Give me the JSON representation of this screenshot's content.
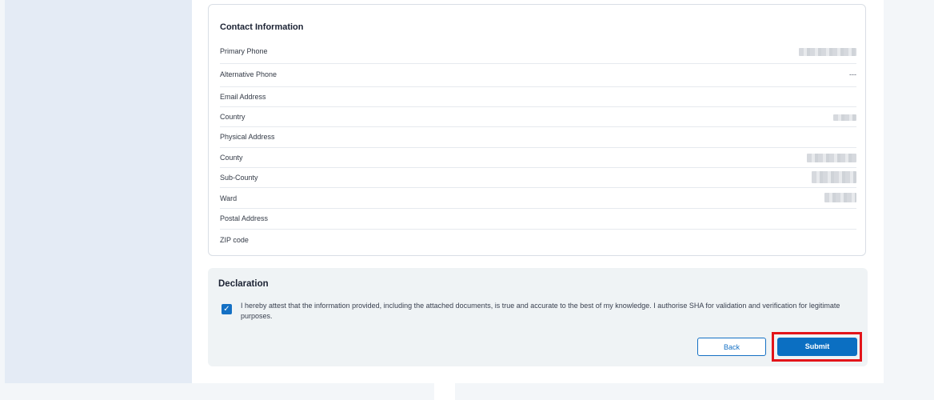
{
  "contact": {
    "title": "Contact Information",
    "rows": [
      {
        "label": "Primary Phone",
        "value": ""
      },
      {
        "label": "Alternative Phone",
        "value": "---"
      },
      {
        "label": "Email Address",
        "value": ""
      },
      {
        "label": "Country",
        "value": ""
      },
      {
        "label": "Physical Address",
        "value": ""
      },
      {
        "label": "County",
        "value": ""
      },
      {
        "label": "Sub-County",
        "value": ""
      },
      {
        "label": "Ward",
        "value": ""
      },
      {
        "label": "Postal Address",
        "value": ""
      },
      {
        "label": "ZIP code",
        "value": ""
      }
    ]
  },
  "declaration": {
    "title": "Declaration",
    "checked": true,
    "text": "I hereby attest that the information provided, including the attached documents, is true and accurate to the best of my knowledge. I authorise SHA for validation and verification for legitimate purposes."
  },
  "actions": {
    "back_label": "Back",
    "submit_label": "Submit"
  },
  "colors": {
    "primary": "#0b6fc2",
    "highlight": "#e3151a"
  }
}
